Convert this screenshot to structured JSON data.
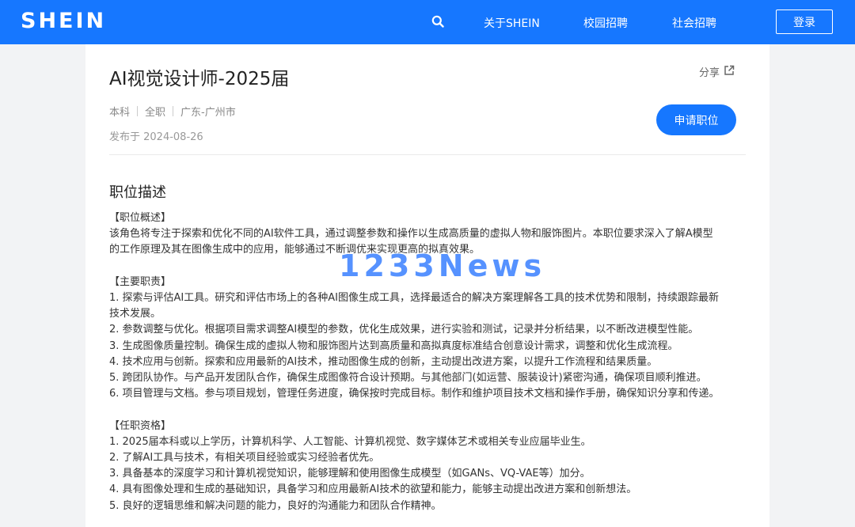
{
  "navbar": {
    "logo": "SHEIN",
    "search_icon": "search-icon",
    "items": [
      "关于SHEIN",
      "校园招聘",
      "社会招聘"
    ],
    "login_label": "登录",
    "bg_color": "#1677ff"
  },
  "job": {
    "title": "AI视觉设计师-2025届",
    "share_label": "分享",
    "share_icon": "share-icon",
    "meta": [
      "本科",
      "全职",
      "广东-广州市"
    ],
    "posted": "发布于 2024-08-26",
    "apply_label": "申请职位"
  },
  "description": {
    "title": "职位描述",
    "lines": [
      "【职位概述】",
      "该角色将专注于探索和优化不同的AI软件工具，通过调整参数和操作以生成高质量的虚拟人物和服饰图片。本职位要求深入了解A模型",
      "的工作原理及其在图像生成中的应用，能够通过不断调优来实现更高的拟真效果。",
      "",
      "【主要职责】",
      "1. 探索与评估AI工具。研究和评估市场上的各种AI图像生成工具，选择最适合的解决方案理解各工具的技术优势和限制，持续跟踪最新",
      "技术发展。",
      "2. 参数调整与优化。根据项目需求调整AI模型的参数，优化生成效果，进行实验和测试，记录并分析结果，以不断改进模型性能。",
      "3. 生成图像质量控制。确保生成的虚拟人物和服饰图片达到高质量和高拟真度标准结合创意设计需求，调整和优化生成流程。",
      "4. 技术应用与创新。探索和应用最新的AI技术，推动图像生成的创新，主动提出改进方案，以提升工作流程和结果质量。",
      "5. 跨团队协作。与产品开发团队合作，确保生成图像符合设计预期。与其他部门(如运营、服装设计)紧密沟通，确保项目顺利推进。",
      "6. 项目管理与文档。参与项目规划，管理任务进度，确保按时完成目标。制作和维护项目技术文档和操作手册，确保知识分享和传递。",
      "",
      "【任职资格】",
      "1. 2025届本科或以上学历，计算机科学、人工智能、计算机视觉、数字媒体艺术或相关专业应届毕业生。",
      "2. 了解AI工具与技术，有相关项目经验或实习经验者优先。",
      "3. 具备基本的深度学习和计算机视觉知识，能够理解和使用图像生成模型（如GANs、VQ-VAE等）加分。",
      "4. 具有图像处理和生成的基础知识，具备学习和应用最新AI技术的欲望和能力，能够主动提出改进方案和创新想法。",
      "5. 良好的逻辑思维和解决问题的能力，良好的沟通能力和团队合作精神。"
    ]
  },
  "watermark": "1233News"
}
